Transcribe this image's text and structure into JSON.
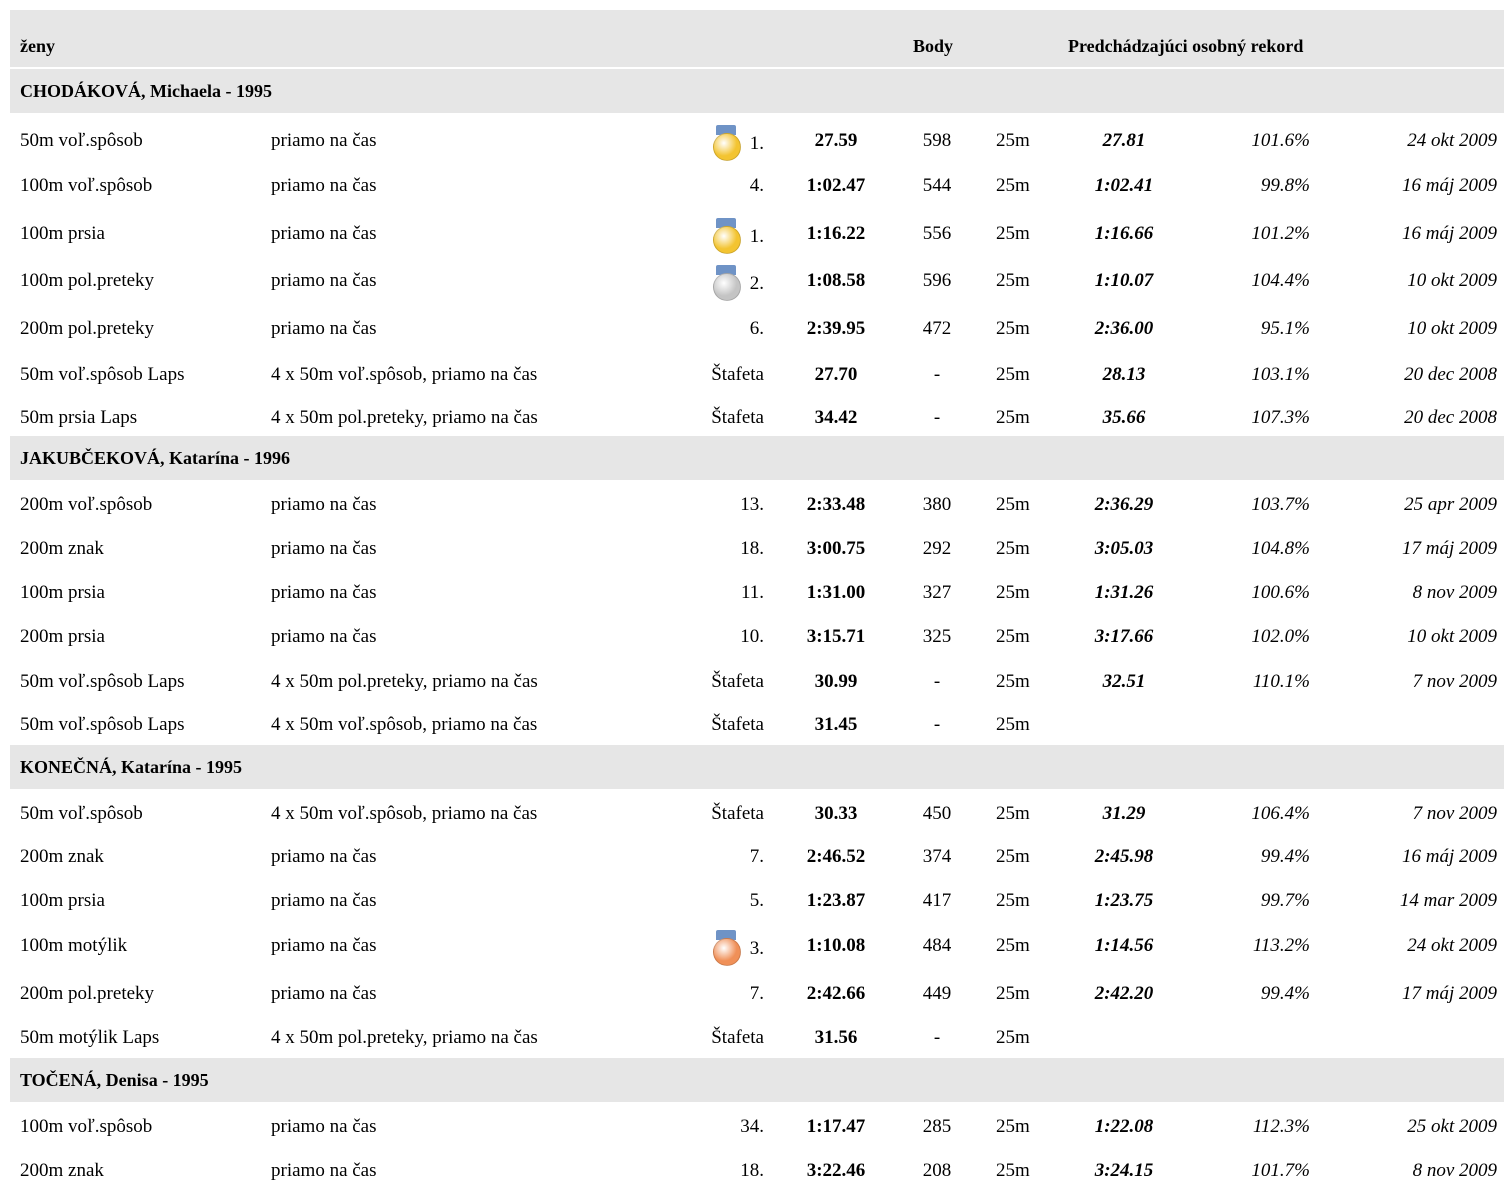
{
  "header": {
    "category": "ženy",
    "points_label": "Body",
    "previous_pb_label": "Predchádzajúci osobný rekord"
  },
  "medal_colors": {
    "1": "#f3c431",
    "2": "#c4c4c4",
    "3": "#f09058"
  },
  "athletes": [
    {
      "name": "CHODÁKOVÁ, Michaela - 1995",
      "events": [
        {
          "event": "50m voľ.spôsob",
          "type": "priamo na čas",
          "place": "1.",
          "medal": "gold-medal-icon",
          "time": "27.59",
          "points": "598",
          "course": "25m",
          "prev_time": "27.81",
          "pct": "101.6%",
          "date": "24 okt 2009"
        },
        {
          "event": "100m voľ.spôsob",
          "type": "priamo na čas",
          "place": "4.",
          "medal": "",
          "time": "1:02.47",
          "points": "544",
          "course": "25m",
          "prev_time": "1:02.41",
          "pct": "99.8%",
          "date": "16 máj 2009"
        },
        {
          "event": "100m prsia",
          "type": "priamo na čas",
          "place": "1.",
          "medal": "gold-medal-icon",
          "time": "1:16.22",
          "points": "556",
          "course": "25m",
          "prev_time": "1:16.66",
          "pct": "101.2%",
          "date": "16 máj 2009"
        },
        {
          "event": "100m pol.preteky",
          "type": "priamo na čas",
          "place": "2.",
          "medal": "silver-medal-icon",
          "time": "1:08.58",
          "points": "596",
          "course": "25m",
          "prev_time": "1:10.07",
          "pct": "104.4%",
          "date": "10 okt 2009"
        },
        {
          "event": "200m pol.preteky",
          "type": "priamo na čas",
          "place": "6.",
          "medal": "",
          "time": "2:39.95",
          "points": "472",
          "course": "25m",
          "prev_time": "2:36.00",
          "pct": "95.1%",
          "date": "10 okt 2009"
        },
        {
          "event": "50m voľ.spôsob Laps",
          "type": "4 x 50m voľ.spôsob, priamo na čas",
          "place": "Štafeta",
          "medal": "",
          "time": "27.70",
          "points": "-",
          "course": "25m",
          "prev_time": "28.13",
          "pct": "103.1%",
          "date": "20 dec 2008"
        },
        {
          "event": "50m prsia Laps",
          "type": "4 x 50m pol.preteky, priamo na čas",
          "place": "Štafeta",
          "medal": "",
          "time": "34.42",
          "points": "-",
          "course": "25m",
          "prev_time": "35.66",
          "pct": "107.3%",
          "date": "20 dec 2008"
        }
      ]
    },
    {
      "name": "JAKUBČEKOVÁ, Katarína - 1996",
      "events": [
        {
          "event": "200m voľ.spôsob",
          "type": "priamo na čas",
          "place": "13.",
          "medal": "",
          "time": "2:33.48",
          "points": "380",
          "course": "25m",
          "prev_time": "2:36.29",
          "pct": "103.7%",
          "date": "25 apr 2009"
        },
        {
          "event": "200m znak",
          "type": "priamo na čas",
          "place": "18.",
          "medal": "",
          "time": "3:00.75",
          "points": "292",
          "course": "25m",
          "prev_time": "3:05.03",
          "pct": "104.8%",
          "date": "17 máj 2009"
        },
        {
          "event": "100m prsia",
          "type": "priamo na čas",
          "place": "11.",
          "medal": "",
          "time": "1:31.00",
          "points": "327",
          "course": "25m",
          "prev_time": "1:31.26",
          "pct": "100.6%",
          "date": "8 nov 2009"
        },
        {
          "event": "200m prsia",
          "type": "priamo na čas",
          "place": "10.",
          "medal": "",
          "time": "3:15.71",
          "points": "325",
          "course": "25m",
          "prev_time": "3:17.66",
          "pct": "102.0%",
          "date": "10 okt 2009"
        },
        {
          "event": "50m voľ.spôsob Laps",
          "type": "4 x 50m pol.preteky, priamo na čas",
          "place": "Štafeta",
          "medal": "",
          "time": "30.99",
          "points": "-",
          "course": "25m",
          "prev_time": "32.51",
          "pct": "110.1%",
          "date": "7 nov 2009"
        },
        {
          "event": "50m voľ.spôsob Laps",
          "type": "4 x 50m voľ.spôsob, priamo na čas",
          "place": "Štafeta",
          "medal": "",
          "time": "31.45",
          "points": "-",
          "course": "25m",
          "prev_time": "",
          "pct": "",
          "date": ""
        }
      ]
    },
    {
      "name": "KONEČNÁ, Katarína - 1995",
      "events": [
        {
          "event": "50m voľ.spôsob",
          "type": "4 x 50m voľ.spôsob, priamo na čas",
          "place": "Štafeta",
          "medal": "",
          "time": "30.33",
          "points": "450",
          "course": "25m",
          "prev_time": "31.29",
          "pct": "106.4%",
          "date": "7 nov 2009"
        },
        {
          "event": "200m znak",
          "type": "priamo na čas",
          "place": "7.",
          "medal": "",
          "time": "2:46.52",
          "points": "374",
          "course": "25m",
          "prev_time": "2:45.98",
          "pct": "99.4%",
          "date": "16 máj 2009"
        },
        {
          "event": "100m prsia",
          "type": "priamo na čas",
          "place": "5.",
          "medal": "",
          "time": "1:23.87",
          "points": "417",
          "course": "25m",
          "prev_time": "1:23.75",
          "pct": "99.7%",
          "date": "14 mar 2009"
        },
        {
          "event": "100m motýlik",
          "type": "priamo na čas",
          "place": "3.",
          "medal": "bronze-medal-icon",
          "time": "1:10.08",
          "points": "484",
          "course": "25m",
          "prev_time": "1:14.56",
          "pct": "113.2%",
          "date": "24 okt 2009"
        },
        {
          "event": "200m pol.preteky",
          "type": "priamo na čas",
          "place": "7.",
          "medal": "",
          "time": "2:42.66",
          "points": "449",
          "course": "25m",
          "prev_time": "2:42.20",
          "pct": "99.4%",
          "date": "17 máj 2009"
        },
        {
          "event": "50m motýlik Laps",
          "type": "4 x 50m pol.preteky, priamo na čas",
          "place": "Štafeta",
          "medal": "",
          "time": "31.56",
          "points": "-",
          "course": "25m",
          "prev_time": "",
          "pct": "",
          "date": ""
        }
      ]
    },
    {
      "name": "TOČENÁ, Denisa - 1995",
      "events": [
        {
          "event": "100m voľ.spôsob",
          "type": "priamo na čas",
          "place": "34.",
          "medal": "",
          "time": "1:17.47",
          "points": "285",
          "course": "25m",
          "prev_time": "1:22.08",
          "pct": "112.3%",
          "date": "25 okt 2009"
        },
        {
          "event": "200m znak",
          "type": "priamo na čas",
          "place": "18.",
          "medal": "",
          "time": "3:22.46",
          "points": "208",
          "course": "25m",
          "prev_time": "3:24.15",
          "pct": "101.7%",
          "date": "8 nov 2009"
        }
      ]
    }
  ]
}
